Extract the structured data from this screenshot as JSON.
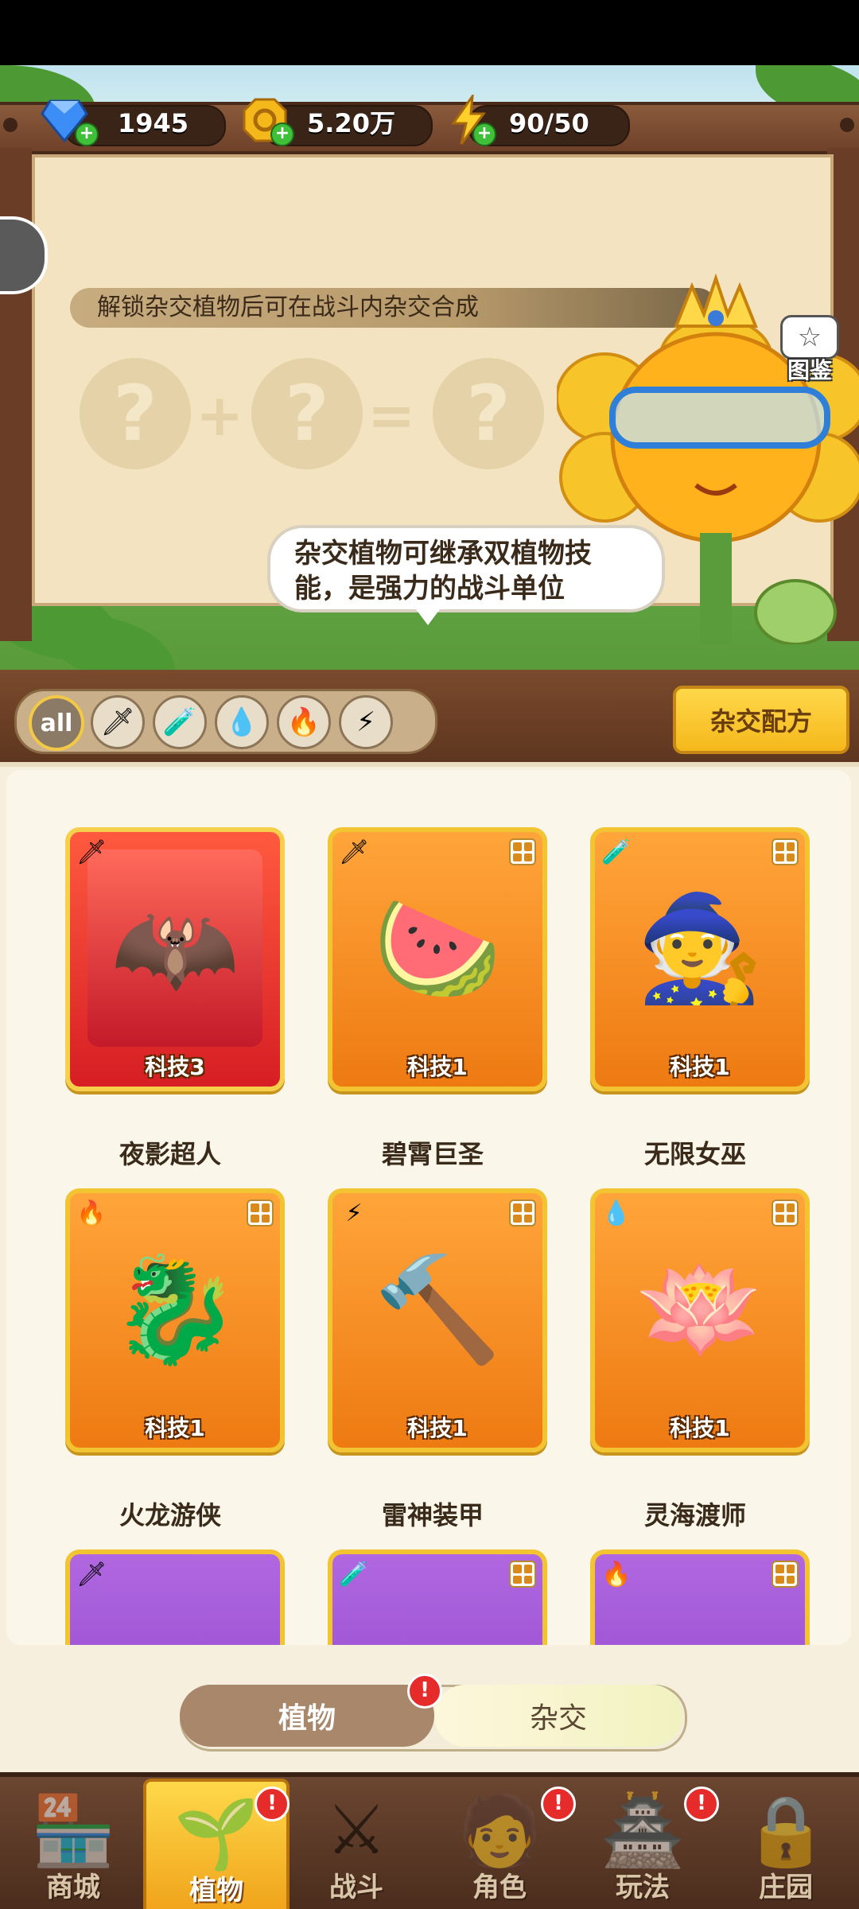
{
  "resources": {
    "gems": "1945",
    "coins": "5.20万",
    "energy": "90/50"
  },
  "board": {
    "hint": "解锁杂交植物后可在战斗内杂交合成",
    "speech": "杂交植物可继承双植物技能，是强力的战斗单位",
    "guide_label": "图鉴"
  },
  "filters": {
    "all_label": "all",
    "items": [
      "all",
      "sword",
      "potion",
      "water",
      "fire",
      "lightning"
    ],
    "selected": "all",
    "recipe_button": "杂交配方"
  },
  "cards": [
    {
      "name": "夜影超人",
      "tech": "科技3",
      "element": "sword",
      "rarity": "red"
    },
    {
      "name": "碧霄巨圣",
      "tech": "科技1",
      "element": "sword",
      "rarity": "orange"
    },
    {
      "name": "无限女巫",
      "tech": "科技1",
      "element": "potion",
      "rarity": "orange"
    },
    {
      "name": "火龙游侠",
      "tech": "科技1",
      "element": "fire",
      "rarity": "orange"
    },
    {
      "name": "雷神装甲",
      "tech": "科技1",
      "element": "lightning",
      "rarity": "orange"
    },
    {
      "name": "灵海渡师",
      "tech": "科技1",
      "element": "water",
      "rarity": "orange"
    },
    {
      "name": "",
      "tech": "",
      "element": "sword",
      "rarity": "purple"
    },
    {
      "name": "",
      "tech": "",
      "element": "potion",
      "rarity": "purple"
    },
    {
      "name": "",
      "tech": "",
      "element": "fire",
      "rarity": "purple"
    }
  ],
  "mode_toggle": {
    "plants": "植物",
    "hybrid": "杂交",
    "selected": "plants"
  },
  "nav": [
    {
      "label": "商城",
      "icon": "shop-icon",
      "alert": false
    },
    {
      "label": "植物",
      "icon": "plants-icon",
      "alert": true,
      "active": true
    },
    {
      "label": "战斗",
      "icon": "battle-icon",
      "alert": false
    },
    {
      "label": "角色",
      "icon": "character-icon",
      "alert": true
    },
    {
      "label": "玩法",
      "icon": "gameplay-icon",
      "alert": true
    },
    {
      "label": "庄园",
      "icon": "manor-lock-icon",
      "alert": false
    }
  ],
  "alert_mark": "!"
}
